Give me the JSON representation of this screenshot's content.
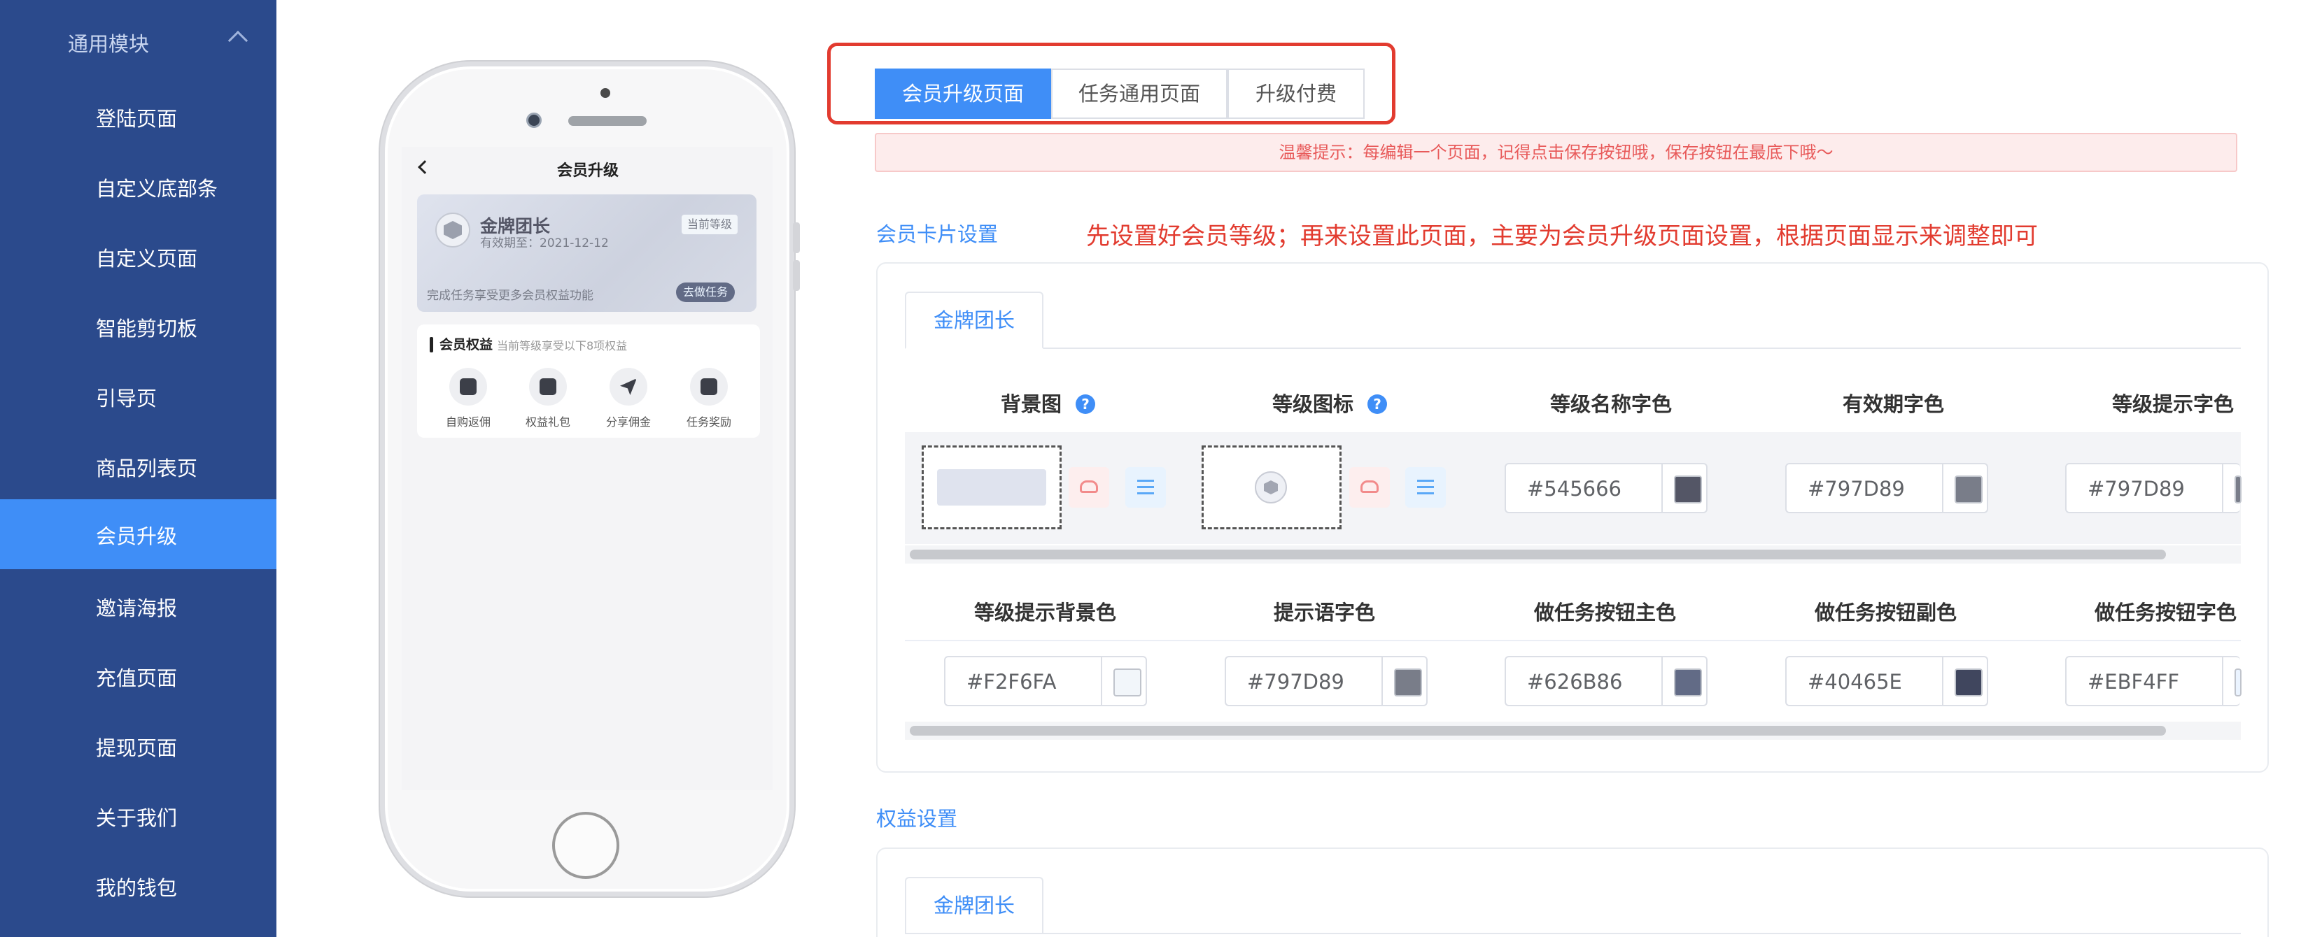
{
  "sidebar": {
    "group_label": "通用模块",
    "items": [
      {
        "label": "登陆页面"
      },
      {
        "label": "自定义底部条"
      },
      {
        "label": "自定义页面"
      },
      {
        "label": "智能剪切板"
      },
      {
        "label": "引导页"
      },
      {
        "label": "商品列表页"
      },
      {
        "label": "会员升级",
        "active": true
      },
      {
        "label": "邀请海报"
      },
      {
        "label": "充值页面"
      },
      {
        "label": "提现页面"
      },
      {
        "label": "关于我们"
      },
      {
        "label": "我的钱包"
      }
    ]
  },
  "phone": {
    "screen_title": "会员升级",
    "card": {
      "level_name": "金牌团长",
      "valid_until": "有效期至：2021-12-12",
      "current_tag": "当前等级",
      "tip": "完成任务享受更多会员权益功能",
      "task_button": "去做任务"
    },
    "rights": {
      "title": "会员权益",
      "subtitle": "当前等级享受以下8项权益",
      "items": [
        {
          "label": "自购返佣",
          "icon": "bag-icon"
        },
        {
          "label": "权益礼包",
          "icon": "gift-icon"
        },
        {
          "label": "分享佣金",
          "icon": "send-icon"
        },
        {
          "label": "任务奖励",
          "icon": "list-icon"
        }
      ]
    }
  },
  "tabs": [
    {
      "label": "会员升级页面",
      "active": true
    },
    {
      "label": "任务通用页面"
    },
    {
      "label": "升级付费"
    }
  ],
  "notice": "温馨提示：每编辑一个页面，记得点击保存按钮哦，保存按钮在最底下哦～",
  "card_settings": {
    "title": "会员卡片设置",
    "hint": "先设置好会员等级；再来设置此页面，主要为会员升级页面设置，根据页面显示来调整即可",
    "level_tab": "金牌团长",
    "row1_headers": [
      "背景图",
      "等级图标",
      "等级名称字色",
      "有效期字色",
      "等级提示字色"
    ],
    "row1_colors": [
      {
        "value": "#545666",
        "swatch": "#545666"
      },
      {
        "value": "#797D89",
        "swatch": "#797D89"
      },
      {
        "value": "#797D89",
        "swatch": "#797D89"
      }
    ],
    "row2_headers": [
      "等级提示背景色",
      "提示语字色",
      "做任务按钮主色",
      "做任务按钮副色",
      "做任务按钮字色"
    ],
    "row2_colors": [
      {
        "value": "#F2F6FA",
        "swatch": "#F2F6FA"
      },
      {
        "value": "#797D89",
        "swatch": "#797D89"
      },
      {
        "value": "#626B86",
        "swatch": "#626B86"
      },
      {
        "value": "#40465E",
        "swatch": "#40465E"
      },
      {
        "value": "#EBF4FF",
        "swatch": "#EBF4FF"
      }
    ]
  },
  "rights_settings": {
    "title": "权益设置",
    "level_tab": "金牌团长"
  },
  "colors": {
    "sidebar_bg": "#2b4a8c",
    "accent": "#3f8ef7",
    "highlight_frame": "#e23b2f"
  }
}
